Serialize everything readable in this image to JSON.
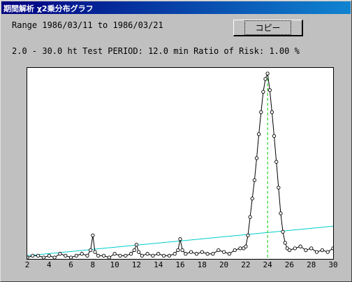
{
  "window": {
    "title": "期間解析 χ2乗分布グラフ"
  },
  "info": {
    "range": "Range 1986/03/11 to 1986/03/21",
    "params": "2.0 - 30.0 ht  Test PERIOD: 12.0 min  Ratio of Risk: 1.00 %"
  },
  "toolbar": {
    "copy_label": "コピー"
  },
  "colors": {
    "title_start": "#000080",
    "title_end": "#1084d0",
    "threshold_line": "#00cccc",
    "peak_marker": "#00cc00",
    "data_line": "#000000"
  },
  "chart_data": {
    "type": "line",
    "title": "",
    "xlabel": "",
    "ylabel": "",
    "xlim": [
      2,
      30
    ],
    "ylim": [
      0,
      100
    ],
    "xticks": [
      "2",
      "4",
      "6",
      "8",
      "10",
      "12",
      "14",
      "16",
      "18",
      "20",
      "22",
      "24",
      "26",
      "28",
      "30"
    ],
    "grid": false,
    "peak_x": 24.0,
    "threshold": {
      "x": [
        2,
        30
      ],
      "y": [
        1,
        17
      ]
    },
    "series": [
      {
        "x": [
          2.0,
          2.5,
          3.0,
          3.5,
          4.0,
          4.5,
          5.0,
          5.5,
          6.0,
          6.5,
          7.0,
          7.5,
          7.8,
          8.0,
          8.2,
          8.5,
          9.0,
          9.5,
          10.0,
          10.5,
          11.0,
          11.5,
          11.8,
          12.0,
          12.2,
          12.5,
          13.0,
          13.5,
          14.0,
          14.5,
          15.0,
          15.5,
          15.8,
          16.0,
          16.2,
          16.5,
          17.0,
          17.5,
          18.0,
          18.5,
          19.0,
          19.5,
          20.0,
          20.5,
          21.0,
          21.5,
          21.8,
          22.0,
          22.2,
          22.4,
          22.6,
          22.8,
          23.0,
          23.2,
          23.4,
          23.6,
          23.8,
          24.0,
          24.2,
          24.4,
          24.6,
          24.8,
          25.0,
          25.2,
          25.4,
          25.6,
          25.8,
          26.0,
          26.5,
          27.0,
          27.5,
          28.0,
          28.5,
          29.0,
          29.5,
          30.0
        ],
        "y": [
          0,
          1,
          1,
          0,
          1,
          0,
          2,
          1,
          0,
          1,
          2,
          1,
          4,
          12,
          3,
          1,
          1,
          0,
          2,
          1,
          1,
          2,
          4,
          7,
          3,
          1,
          2,
          1,
          2,
          1,
          1,
          2,
          4,
          10,
          4,
          2,
          3,
          2,
          3,
          2,
          2,
          4,
          3,
          2,
          4,
          5,
          5,
          6,
          12,
          22,
          32,
          42,
          54,
          67,
          79,
          90,
          97,
          100,
          91,
          79,
          66,
          52,
          38,
          24,
          14,
          8,
          5,
          4,
          5,
          6,
          4,
          5,
          3,
          4,
          3,
          5
        ]
      }
    ]
  }
}
